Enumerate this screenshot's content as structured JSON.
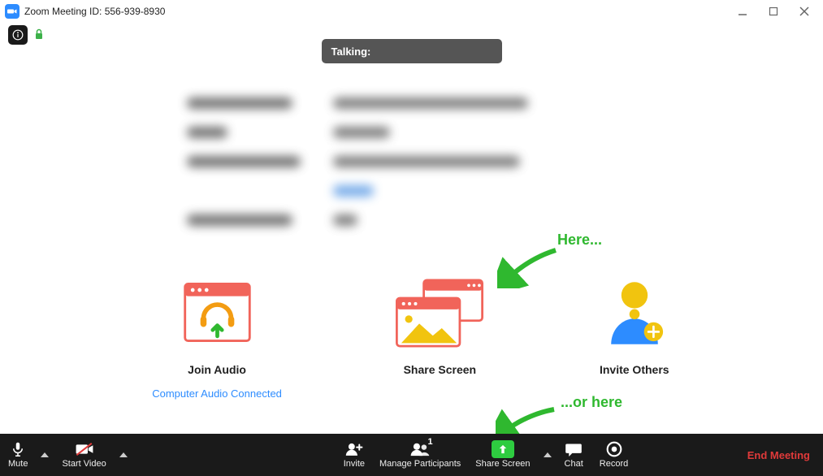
{
  "window": {
    "title": "Zoom Meeting ID: 556-939-8930"
  },
  "talking": {
    "label": "Talking:"
  },
  "cards": {
    "joinAudio": {
      "title": "Join Audio",
      "subtitle": "Computer Audio Connected"
    },
    "shareScreen": {
      "title": "Share Screen"
    },
    "inviteOthers": {
      "title": "Invite Others"
    }
  },
  "toolbar": {
    "mute": "Mute",
    "startVideo": "Start Video",
    "invite": "Invite",
    "manageParticipants": "Manage Participants",
    "participantsCount": "1",
    "shareScreen": "Share Screen",
    "chat": "Chat",
    "record": "Record",
    "endMeeting": "End Meeting"
  },
  "annotations": {
    "here": "Here...",
    "orHere": "...or here"
  },
  "colors": {
    "accentBlue": "#2d8cff",
    "green": "#2ecc40",
    "annotationGreen": "#2fb82f",
    "endRed": "#e03a3a",
    "coral": "#f1645a"
  }
}
